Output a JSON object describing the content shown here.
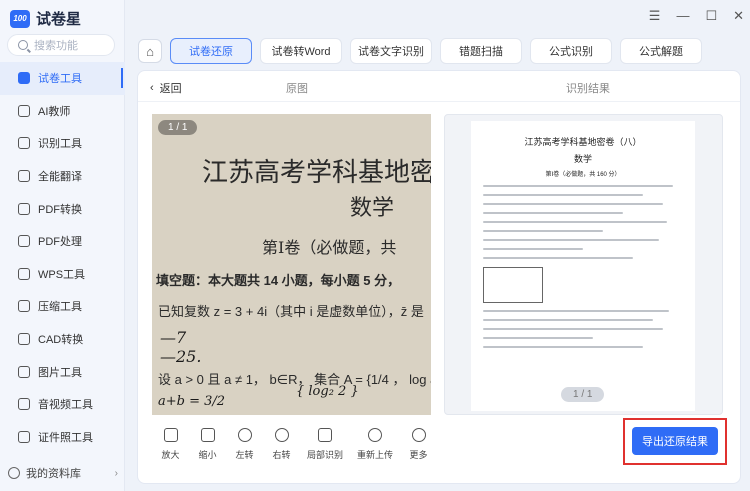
{
  "app": {
    "name": "试卷星",
    "logo_text": "100"
  },
  "search": {
    "placeholder": "搜索功能"
  },
  "sidebar": {
    "items": [
      {
        "label": "试卷工具",
        "icon": "layers-icon",
        "active": true
      },
      {
        "label": "AI教师",
        "icon": "teacher-icon"
      },
      {
        "label": "识别工具",
        "icon": "scan-icon"
      },
      {
        "label": "全能翻译",
        "icon": "translate-icon"
      },
      {
        "label": "PDF转换",
        "icon": "convert-icon"
      },
      {
        "label": "PDF处理",
        "icon": "pdf-icon"
      },
      {
        "label": "WPS工具",
        "icon": "wps-icon"
      },
      {
        "label": "压缩工具",
        "icon": "compress-icon"
      },
      {
        "label": "CAD转换",
        "icon": "cad-icon"
      },
      {
        "label": "图片工具",
        "icon": "image-icon"
      },
      {
        "label": "音视频工具",
        "icon": "video-icon"
      },
      {
        "label": "证件照工具",
        "icon": "id-photo-icon"
      }
    ],
    "library": "我的资料库"
  },
  "window": {
    "menu": "☰",
    "minimize": "—",
    "maximize": "☐",
    "close": "✕"
  },
  "tabs": [
    {
      "label": "试卷还原",
      "active": true
    },
    {
      "label": "试卷转Word"
    },
    {
      "label": "试卷文字识别"
    },
    {
      "label": "错题扫描"
    },
    {
      "label": "公式识别"
    },
    {
      "label": "公式解题"
    }
  ],
  "panel": {
    "back": "返回",
    "original_label": "原图",
    "result_label": "识别结果",
    "original_page": "1 / 1",
    "result_page": "1 / 1"
  },
  "original": {
    "line1": "江苏高考学科基地密",
    "line2": "数学",
    "line3": "第Ⅰ卷（必做题，共",
    "line4": "填空题：本大题共 14 小题，每小题 5 分，",
    "line5": "已知复数 z = 3 + 4i（其中 i 是虚数单位），z̄ 是",
    "line6": "设 a > 0 且 a ≠ 1， b∈R， 集合 A = {1/4 ， log a 2}"
  },
  "result_doc": {
    "title": "江苏高考学科基地密卷（八）",
    "subject": "数学",
    "section": "第Ⅰ卷（必做题，共 160 分）"
  },
  "tools": [
    {
      "label": "放大",
      "icon": "zoom-in-icon"
    },
    {
      "label": "缩小",
      "icon": "zoom-out-icon"
    },
    {
      "label": "左转",
      "icon": "rotate-left-icon"
    },
    {
      "label": "右转",
      "icon": "rotate-right-icon"
    },
    {
      "label": "局部识别",
      "icon": "crop-icon"
    },
    {
      "label": "重新上传",
      "icon": "reupload-icon"
    },
    {
      "label": "更多",
      "icon": "more-icon"
    }
  ],
  "export_label": "导出还原结果"
}
